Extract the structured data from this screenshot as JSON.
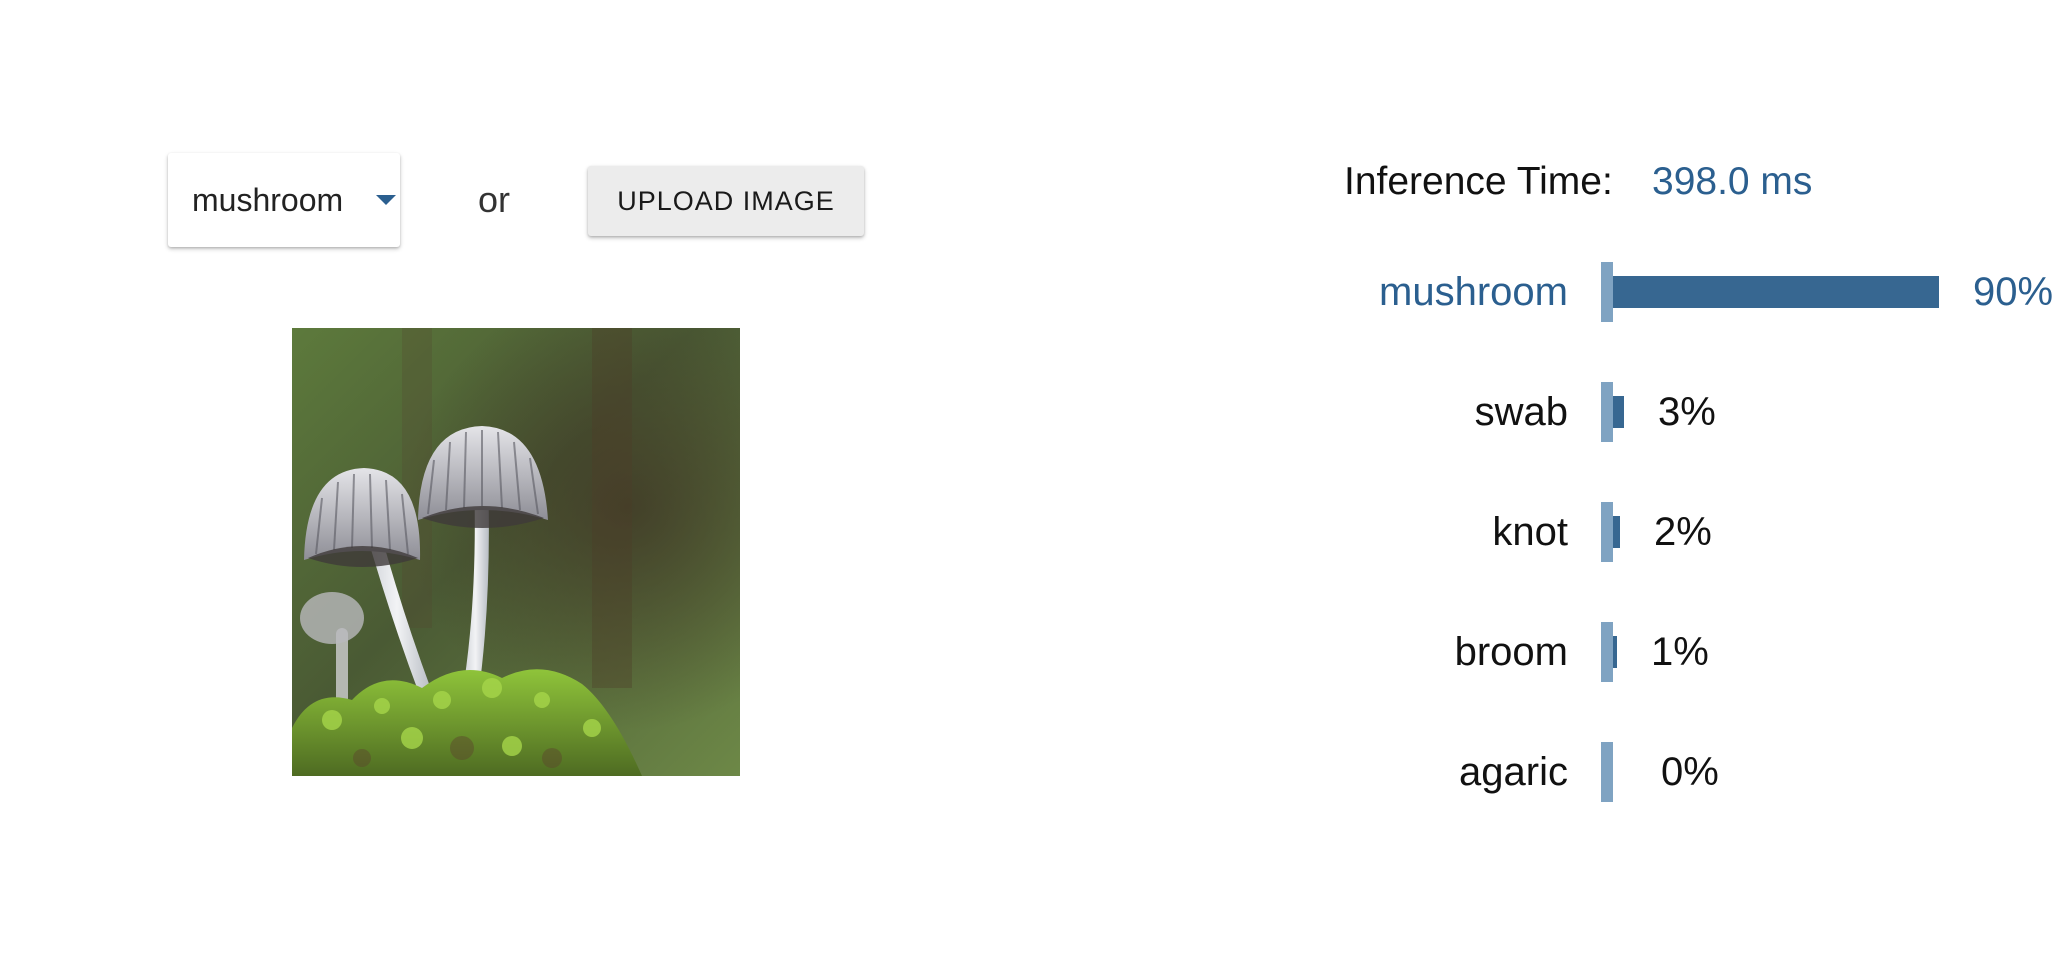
{
  "selector": {
    "selected_value": "mushroom"
  },
  "or_text": "or",
  "upload_button": {
    "label": "UPLOAD IMAGE"
  },
  "preview_image": {
    "subject": "three small grey mushrooms on green moss"
  },
  "inference": {
    "label": "Inference Time:",
    "value": "398.0 ms"
  },
  "results": [
    {
      "label": "mushroom",
      "percent_text": "90%",
      "fraction": 0.9
    },
    {
      "label": "swab",
      "percent_text": "3%",
      "fraction": 0.03
    },
    {
      "label": "knot",
      "percent_text": "2%",
      "fraction": 0.02
    },
    {
      "label": "broom",
      "percent_text": "1%",
      "fraction": 0.01
    },
    {
      "label": "agaric",
      "percent_text": "0%",
      "fraction": 0.0
    }
  ],
  "colors": {
    "accent": "#2b5f8f",
    "bar": "#376791",
    "marker": "#7fa3c2"
  }
}
